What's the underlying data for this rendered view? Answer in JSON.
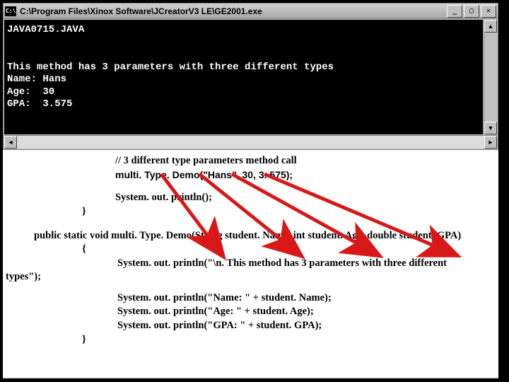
{
  "titlebar": {
    "path": "C:\\Program Files\\Xinox Software\\JCreatorV3 LE\\GE2001.exe"
  },
  "winbtns": {
    "min": "_",
    "max": "▢",
    "close": "✕"
  },
  "scroll": {
    "up": "▲",
    "down": "▼",
    "left": "◄",
    "right": "►"
  },
  "console": {
    "line1": "JAVA0715.JAVA",
    "line2": "",
    "line3": "",
    "line4": "This method has 3 parameters with three different types",
    "line5": "Name: Hans",
    "line6": "Age:  30",
    "line7": "GPA:  3.575"
  },
  "code": {
    "comment": "// 3 different type parameters method call",
    "call": "multi. Type. Demo(\"Hans\", 30, 3. 575);",
    "println_empty": "System. out. println();",
    "brace_close1": "}",
    "method_sig": "public static void multi. Type. Demo(String student. Name, int student. Age, double student. GPA)",
    "brace_open": "{",
    "body1": "System. out. println(\"\\n. This method has 3 parameters with three different",
    "body1_wrap": "types\");",
    "body2": "System. out. println(\"Name: \" + student. Name);",
    "body3": "System. out. println(\"Age:   \" + student. Age);",
    "body4": "System. out. println(\"GPA:  \" + student. GPA);",
    "brace_close2": "}"
  }
}
